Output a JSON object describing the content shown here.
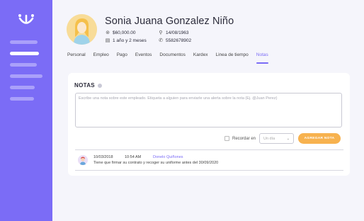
{
  "colors": {
    "accent": "#7b6cf6",
    "button": "#f7b24f",
    "sidebar": "#7b6cf6"
  },
  "sidebar": {
    "logo_icon": "tu-logo-icon",
    "items": [
      {
        "state": "inactive"
      },
      {
        "state": "active"
      },
      {
        "state": "inactive"
      },
      {
        "state": "inactive"
      },
      {
        "state": "inactive"
      },
      {
        "state": "inactive"
      }
    ]
  },
  "profile": {
    "name": "Sonia Juana Gonzalez Niño",
    "salary": "$60,000.00",
    "birthdate": "14/08/1963",
    "tenure": "1 año y 2 meses",
    "phone": "5582678902"
  },
  "tabs": [
    {
      "label": "Personal"
    },
    {
      "label": "Empleo"
    },
    {
      "label": "Pago"
    },
    {
      "label": "Eventos"
    },
    {
      "label": "Documentos"
    },
    {
      "label": "Kardex"
    },
    {
      "label": "Linea de tiempo"
    },
    {
      "label": "Notas",
      "active": true
    }
  ],
  "notes_section": {
    "title": "NOTAS",
    "input_placeholder": "Escribe una nota sobre este empleado. Etiqueta a alguien para enviarle una alerta sobre la nota (Ej. @Juan Perez)",
    "remember_label": "Recordar en",
    "select_value": "Un día",
    "add_button": "AGREGAR NOTA"
  },
  "notes": [
    {
      "date": "10/03/2018",
      "time": "10:54 AM",
      "author": "Donelo Quiñones",
      "text": "Tiene que firmar su contrato y recoger su uniforme antes del 30/09/2020"
    }
  ]
}
